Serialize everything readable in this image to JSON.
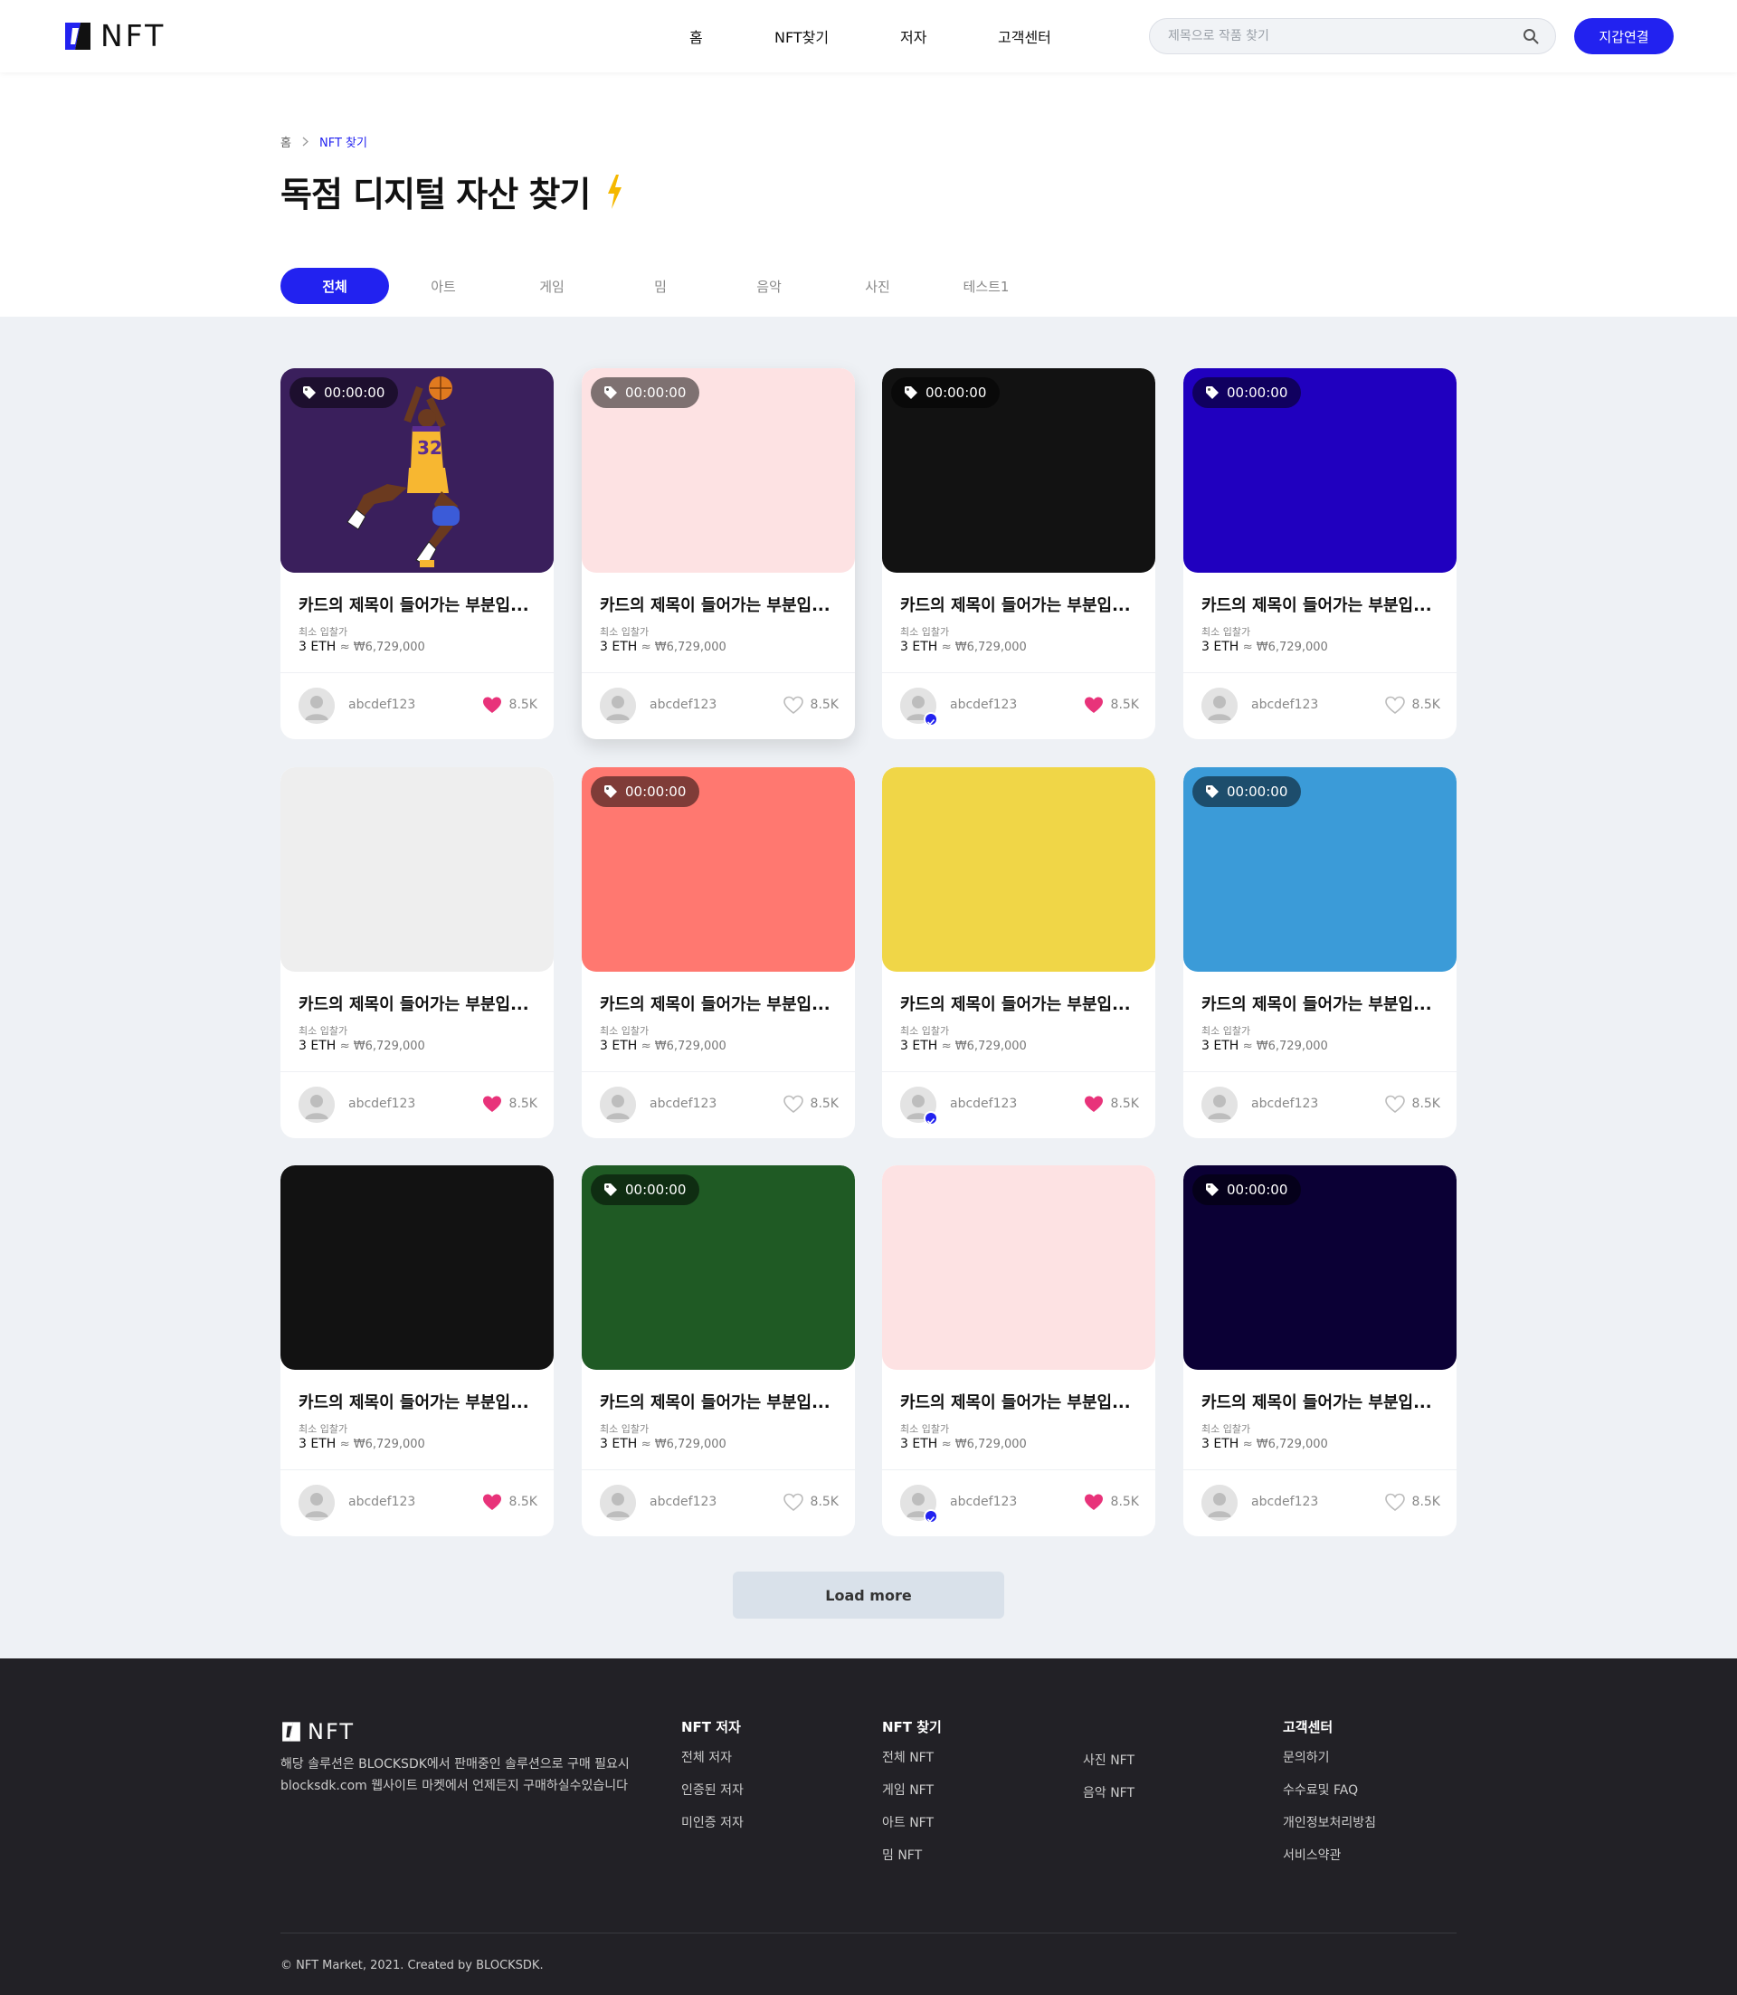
{
  "header": {
    "logo_text": "NFT",
    "nav": [
      "홈",
      "NFT찾기",
      "저자",
      "고객센터"
    ],
    "search_placeholder": "제목으로 작품 찾기",
    "wallet_button": "지갑연결"
  },
  "breadcrumb": {
    "home": "홈",
    "current": "NFT 찾기"
  },
  "page_title": "독점 디지털 자산 찾기",
  "tabs": [
    "전체",
    "아트",
    "게임",
    "밈",
    "음악",
    "사진",
    "테스트1"
  ],
  "active_tab": "전체",
  "cards": [
    {
      "thumb_color": "#3a1f5c",
      "has_image": true,
      "timer": "00:00:00",
      "title": "카드의 제목이 들어가는 부분입...",
      "bid_label": "최소 입찰가",
      "eth": "3 ETH",
      "krw": "≈ ₩6,729,000",
      "owner": "abcdef123",
      "likes": "8.5K",
      "liked": true,
      "verified": false
    },
    {
      "thumb_color": "#fde2e3",
      "has_image": false,
      "timer": "00:00:00",
      "title": "카드의 제목이 들어가는 부분입...",
      "bid_label": "최소 입찰가",
      "eth": "3 ETH",
      "krw": "≈ ₩6,729,000",
      "owner": "abcdef123",
      "likes": "8.5K",
      "liked": false,
      "verified": false
    },
    {
      "thumb_color": "#121212",
      "has_image": false,
      "timer": "00:00:00",
      "title": "카드의 제목이 들어가는 부분입...",
      "bid_label": "최소 입찰가",
      "eth": "3 ETH",
      "krw": "≈ ₩6,729,000",
      "owner": "abcdef123",
      "likes": "8.5K",
      "liked": true,
      "verified": true
    },
    {
      "thumb_color": "#2000bf",
      "has_image": false,
      "timer": "00:00:00",
      "title": "카드의 제목이 들어가는 부분입...",
      "bid_label": "최소 입찰가",
      "eth": "3 ETH",
      "krw": "≈ ₩6,729,000",
      "owner": "abcdef123",
      "likes": "8.5K",
      "liked": false,
      "verified": false
    },
    {
      "thumb_color": "#eeeeee",
      "has_image": false,
      "timer": "",
      "title": "카드의 제목이 들어가는 부분입...",
      "bid_label": "최소 입찰가",
      "eth": "3 ETH",
      "krw": "≈ ₩6,729,000",
      "owner": "abcdef123",
      "likes": "8.5K",
      "liked": true,
      "verified": false
    },
    {
      "thumb_color": "#ff7870",
      "has_image": false,
      "timer": "00:00:00",
      "title": "카드의 제목이 들어가는 부분입...",
      "bid_label": "최소 입찰가",
      "eth": "3 ETH",
      "krw": "≈ ₩6,729,000",
      "owner": "abcdef123",
      "likes": "8.5K",
      "liked": false,
      "verified": false
    },
    {
      "thumb_color": "#f0d647",
      "has_image": false,
      "timer": "",
      "title": "카드의 제목이 들어가는 부분입...",
      "bid_label": "최소 입찰가",
      "eth": "3 ETH",
      "krw": "≈ ₩6,729,000",
      "owner": "abcdef123",
      "likes": "8.5K",
      "liked": true,
      "verified": true
    },
    {
      "thumb_color": "#3b9bd8",
      "has_image": false,
      "timer": "00:00:00",
      "title": "카드의 제목이 들어가는 부분입...",
      "bid_label": "최소 입찰가",
      "eth": "3 ETH",
      "krw": "≈ ₩6,729,000",
      "owner": "abcdef123",
      "likes": "8.5K",
      "liked": false,
      "verified": false
    },
    {
      "thumb_color": "#121212",
      "has_image": false,
      "timer": "",
      "title": "카드의 제목이 들어가는 부분입...",
      "bid_label": "최소 입찰가",
      "eth": "3 ETH",
      "krw": "≈ ₩6,729,000",
      "owner": "abcdef123",
      "likes": "8.5K",
      "liked": true,
      "verified": false
    },
    {
      "thumb_color": "#1f5a24",
      "has_image": false,
      "timer": "00:00:00",
      "title": "카드의 제목이 들어가는 부분입...",
      "bid_label": "최소 입찰가",
      "eth": "3 ETH",
      "krw": "≈ ₩6,729,000",
      "owner": "abcdef123",
      "likes": "8.5K",
      "liked": false,
      "verified": false
    },
    {
      "thumb_color": "#fde2e3",
      "has_image": false,
      "timer": "",
      "title": "카드의 제목이 들어가는 부분입...",
      "bid_label": "최소 입찰가",
      "eth": "3 ETH",
      "krw": "≈ ₩6,729,000",
      "owner": "abcdef123",
      "likes": "8.5K",
      "liked": true,
      "verified": true
    },
    {
      "thumb_color": "#0b0035",
      "has_image": false,
      "timer": "00:00:00",
      "title": "카드의 제목이 들어가는 부분입...",
      "bid_label": "최소 입찰가",
      "eth": "3 ETH",
      "krw": "≈ ₩6,729,000",
      "owner": "abcdef123",
      "likes": "8.5K",
      "liked": false,
      "verified": false
    }
  ],
  "load_more": "Load more",
  "footer": {
    "logo_text": "NFT",
    "description": "해당 솔루션은 BLOCKSDK에서 판매중인 솔루션으로 구매 필요시 blocksdk.com 웹사이트 마켓에서 언제든지 구매하실수있습니다",
    "columns": [
      {
        "title": "NFT 저자",
        "links": [
          "전체 저자",
          "인증된 저자",
          "미인증 저자"
        ]
      },
      {
        "title": "NFT 찾기",
        "links": [
          "전체 NFT",
          "게임 NFT",
          "아트 NFT",
          "밈 NFT"
        ]
      },
      {
        "title": "",
        "links": [
          "사진 NFT",
          "음악 NFT"
        ]
      },
      {
        "title": "고객센터",
        "links": [
          "문의하기",
          "수수료및 FAQ",
          "개인정보처리방침",
          "서비스약관"
        ]
      }
    ],
    "copyright": "© NFT Market, 2021. Created by BLOCKSDK."
  },
  "colors": {
    "accent": "#2222f0",
    "like": "#e8337a",
    "footer_bg": "#222126",
    "grid_bg": "#eef1f5"
  },
  "icons": {
    "search": "search-icon",
    "tag": "tag-icon",
    "heart": "heart-icon",
    "bolt": "lightning-icon",
    "chevron": "chevron-right-icon"
  }
}
